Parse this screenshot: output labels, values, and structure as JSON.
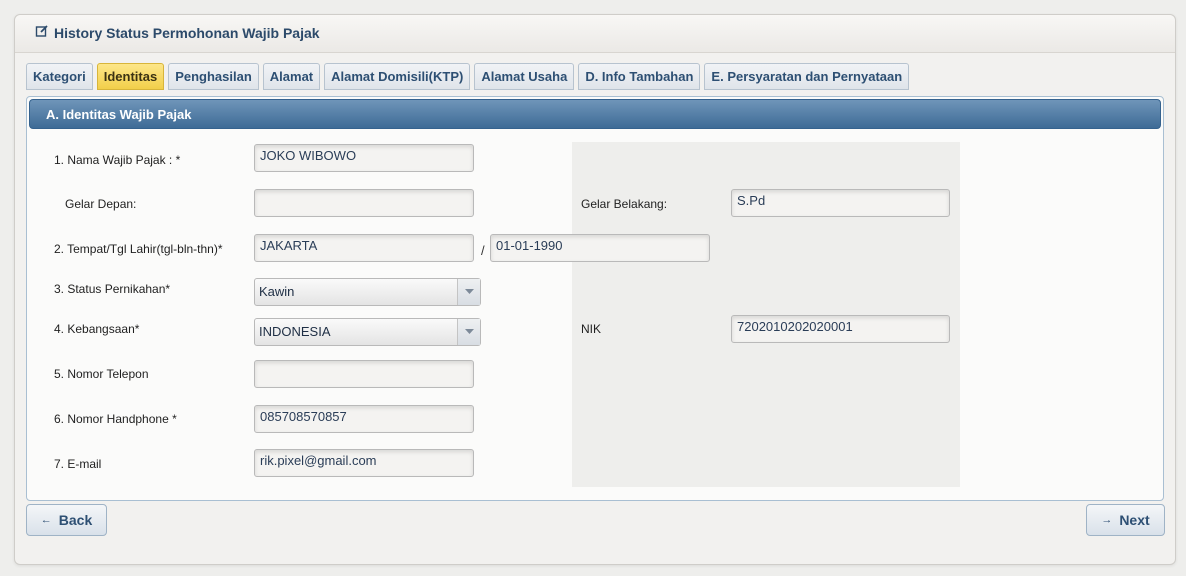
{
  "header": {
    "title": "History Status Permohonan Wajib Pajak"
  },
  "tabs": [
    {
      "label": "Kategori"
    },
    {
      "label": "Identitas"
    },
    {
      "label": "Penghasilan"
    },
    {
      "label": "Alamat"
    },
    {
      "label": "Alamat Domisili(KTP)"
    },
    {
      "label": "Alamat Usaha"
    },
    {
      "label": "D. Info Tambahan"
    },
    {
      "label": "E. Persyaratan dan Pernyataan"
    }
  ],
  "active_tab": "Identitas",
  "panel": {
    "title": "A. Identitas Wajib Pajak"
  },
  "form": {
    "nama": {
      "label": "1. Nama Wajib Pajak : *",
      "value": "JOKO WIBOWO"
    },
    "gelar_depan": {
      "label": "Gelar Depan:",
      "value": ""
    },
    "gelar_belakang": {
      "label": "Gelar Belakang:",
      "value": "S.Pd"
    },
    "ttl": {
      "label": "2. Tempat/Tgl Lahir(tgl-bln-thn)*",
      "tempat": "JAKARTA",
      "separator": "/",
      "tanggal": "01-01-1990"
    },
    "status": {
      "label": "3. Status Pernikahan*",
      "value": "Kawin"
    },
    "kebangsaan": {
      "label": "4. Kebangsaan*",
      "value": "INDONESIA"
    },
    "nik": {
      "label": "NIK",
      "value": "7202010202020001"
    },
    "telepon": {
      "label": "5. Nomor Telepon",
      "value": ""
    },
    "handphone": {
      "label": "6. Nomor Handphone *",
      "value": "085708570857"
    },
    "email": {
      "label": "7. E-mail",
      "value": "rik.pixel@gmail.com"
    }
  },
  "buttons": {
    "back": "Back",
    "next": "Next"
  },
  "colors": {
    "accent": "#3e6b96",
    "tab_active": "#f2cf4a",
    "title": "#2c4a6a"
  }
}
